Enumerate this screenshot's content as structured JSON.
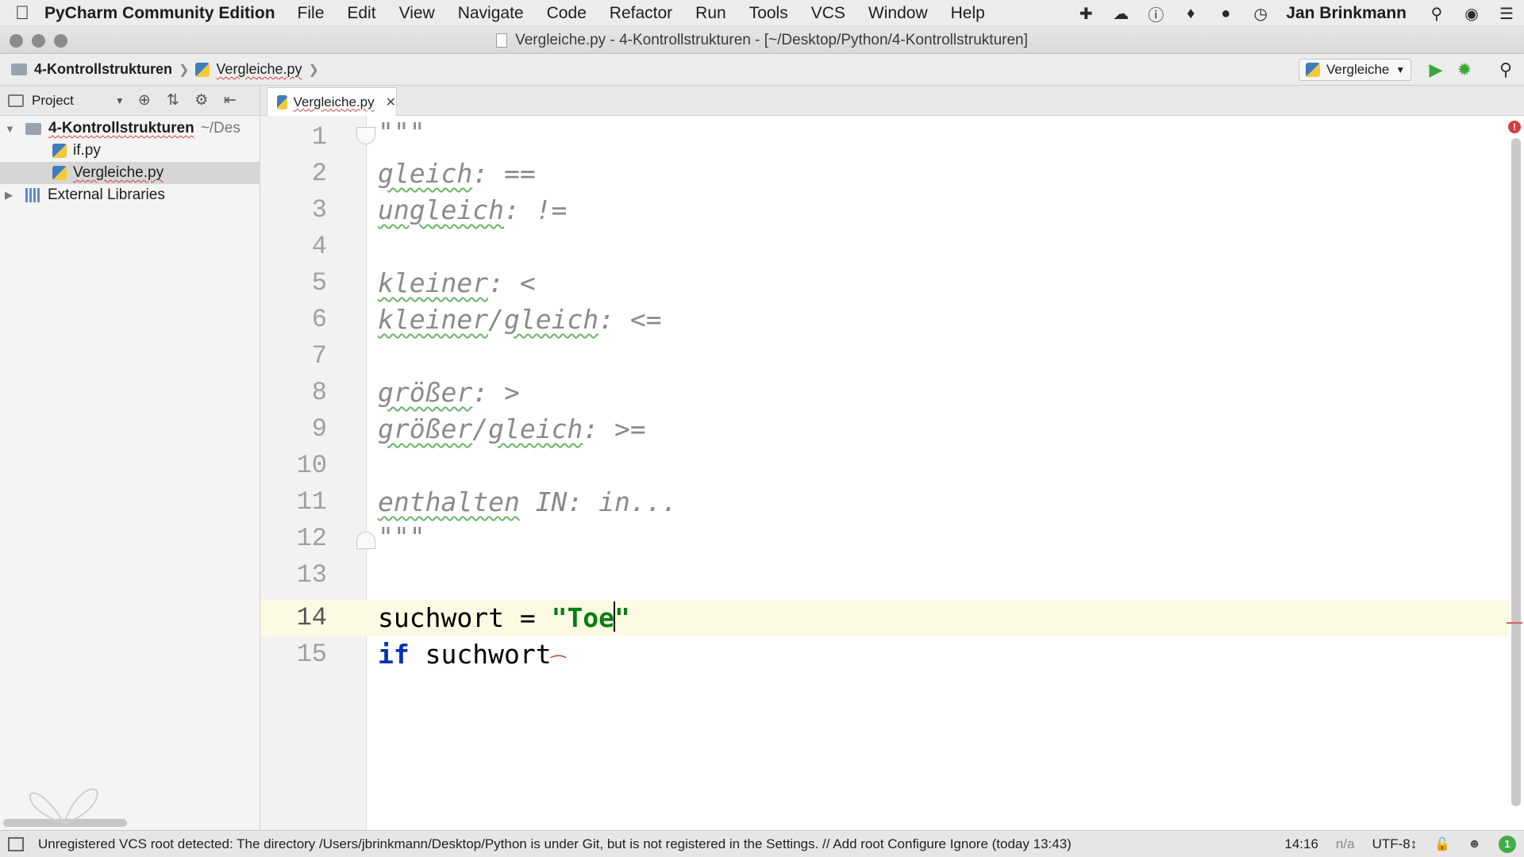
{
  "menubar": {
    "app_name": "PyCharm Community Edition",
    "items": [
      "File",
      "Edit",
      "View",
      "Navigate",
      "Code",
      "Refactor",
      "Run",
      "Tools",
      "VCS",
      "Window",
      "Help"
    ],
    "user": "Jan Brinkmann"
  },
  "window": {
    "title": "Vergleiche.py - 4-Kontrollstrukturen - [~/Desktop/Python/4-Kontrollstrukturen]"
  },
  "navbar": {
    "project_crumb": "4-Kontrollstrukturen",
    "file_crumb": "Vergleiche.py",
    "run_config": "Vergleiche"
  },
  "project_panel": {
    "header": "Project",
    "root": {
      "name": "4-Kontrollstrukturen",
      "path": "~/Des"
    },
    "files": [
      "if.py",
      "Vergleiche.py"
    ],
    "libraries": "External Libraries"
  },
  "editor": {
    "tab_label": "Vergleiche.py",
    "line_numbers": [
      "1",
      "2",
      "3",
      "4",
      "5",
      "6",
      "7",
      "8",
      "9",
      "10",
      "11",
      "12",
      "13",
      "14",
      "15"
    ],
    "current_line": 14,
    "doc_lines": {
      "l1": "\"\"\"",
      "l2_word": "gleich",
      "l2_rest": ": ==",
      "l3_word": "ungleich",
      "l3_rest": ": !=",
      "l5_word": "kleiner",
      "l5_rest": ": <",
      "l6_word": "kleiner",
      "l6_sep": "/",
      "l6_word2": "gleich",
      "l6_rest": ": <=",
      "l8_word": "größer",
      "l8_rest": ": >",
      "l9_word": "größer",
      "l9_sep": "/",
      "l9_word2": "gleich",
      "l9_rest": ": >=",
      "l11_word": "enthalten",
      "l11_rest": " IN: in...",
      "l12": "\"\"\""
    },
    "code": {
      "l14_ident": "suchwort",
      "l14_op": " = ",
      "l14_str_open": "\"Toe",
      "l14_str_close": "\"",
      "l15_kw": "if",
      "l15_ident": " suchwort"
    }
  },
  "statusbar": {
    "message": "Unregistered VCS root detected: The directory /Users/jbrinkmann/Desktop/Python is under Git, but is not registered in the Settings. // Add root  Configure  Ignore (today 13:43)",
    "position": "14:16",
    "na": "n/a",
    "encoding": "UTF-8↕",
    "event_count": "1"
  },
  "colors": {
    "keyword": "#0033b3",
    "string": "#067d17",
    "docstring": "#8a8a8a",
    "current_line": "#fcfae3",
    "run_green": "#3aa63a"
  }
}
